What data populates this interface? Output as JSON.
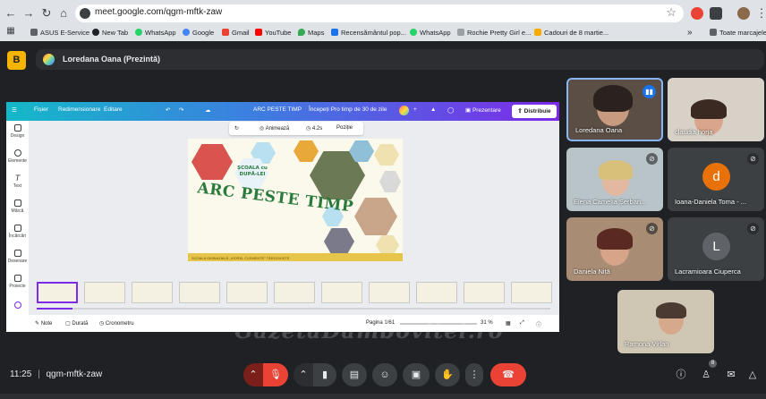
{
  "browser": {
    "url": "meet.google.com/qgm-mftk-zaw",
    "bookmarks": [
      {
        "label": "ASUS E-Service",
        "color": "#5f6368"
      },
      {
        "label": "New Tab",
        "color": "#202124"
      },
      {
        "label": "WhatsApp",
        "color": "#25d366"
      },
      {
        "label": "Google",
        "color": "#4285f4"
      },
      {
        "label": "Gmail",
        "color": "#ea4335"
      },
      {
        "label": "YouTube",
        "color": "#ff0000"
      },
      {
        "label": "Maps",
        "color": "#34a853"
      },
      {
        "label": "Recensământul pop...",
        "color": "#1a73e8"
      },
      {
        "label": "WhatsApp",
        "color": "#25d366"
      },
      {
        "label": "Rochie Pretty Girl e...",
        "color": "#9aa0a6"
      },
      {
        "label": "Cadouri de 8 martie...",
        "color": "#f9ab00"
      }
    ],
    "more_bookmarks": "»",
    "all_bookmarks": "Toate marcajele"
  },
  "meet": {
    "presenter_logo": "B",
    "presenter_label": "Loredana Oana (Prezintă)",
    "time": "11:25",
    "separator": "|",
    "meeting_code": "qgm-mftk-zaw",
    "watermark": "GazetaDambovitei.ro",
    "people_count": "8"
  },
  "canva": {
    "menu": [
      "Fișier",
      "Redimensionare",
      "Editare"
    ],
    "doc_title": "ARC PESTE TIMP",
    "trial": "Începeți Pro timp de 30 de zile",
    "present": "Prezentare",
    "share": "Distribuie",
    "toolbar": [
      "Animează",
      "4.2s",
      "Poziție"
    ],
    "tools": [
      "Design",
      "Elemente",
      "Text",
      "Mărcă",
      "Încărcări",
      "Desenare",
      "Proiecte"
    ],
    "slide_title": "ARC PESTE TIMP",
    "slide_subtitle": "ȘCOALA cu DUPĂ-LEI",
    "slide_footer": "ȘCOALA GIMNAZIALĂ „VIOREL CLEMENTE” TÂRGOVIȘTE",
    "bottom_left": [
      "Note",
      "Durată",
      "Cronometru"
    ],
    "page_info": "Pagina 1/61",
    "zoom": "31 %",
    "progress_fraction": 0.07
  },
  "participants": [
    {
      "name": "Loredana Oana",
      "speaking": true
    },
    {
      "name": "claudia horja",
      "muted": false
    },
    {
      "name": "Elena Camelia Șerban...",
      "muted": true
    },
    {
      "name": "Ioana-Daniela Toma - ...",
      "muted": true,
      "letter": "d",
      "color": "#e8710a"
    },
    {
      "name": "Daniela Niță",
      "muted": true
    },
    {
      "name": "Lacramioara Ciuperca",
      "muted": true,
      "letter": "L",
      "color": "#5f6368"
    },
    {
      "name": "Ramona Virlan",
      "muted": false
    }
  ]
}
